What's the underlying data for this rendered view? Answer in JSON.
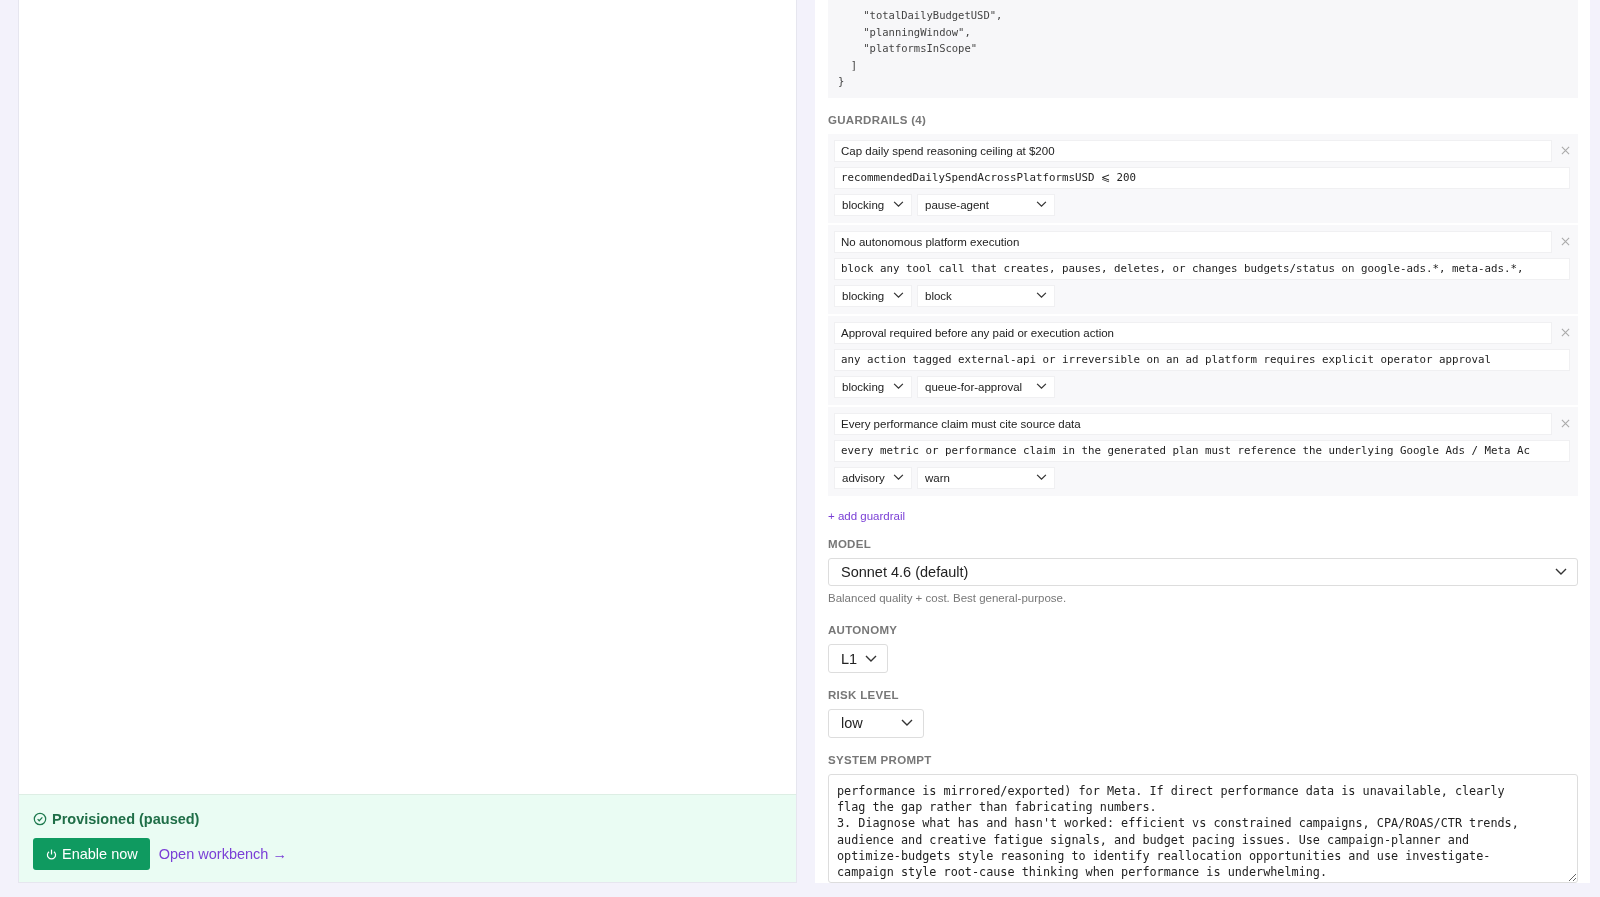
{
  "left_panel": {
    "status": {
      "label": "Provisioned (paused)"
    },
    "enable_button": "Enable now",
    "workbench_link": "Open workbench →"
  },
  "schema_code": [
    "    \"totalDailyBudgetUSD\",",
    "    \"planningWindow\",",
    "    \"platformsInScope\"",
    "  ]",
    "}"
  ],
  "guardrails": {
    "heading": "GUARDRAILS (4)",
    "items": [
      {
        "title": "Cap daily spend reasoning ceiling at $200",
        "rule": "recommendedDailySpendAcrossPlatformsUSD ⩽ 200",
        "severity": "blocking",
        "action": "pause-agent"
      },
      {
        "title": "No autonomous platform execution",
        "rule": "block any tool call that creates, pauses, deletes, or changes budgets/status on google-ads.*, meta-ads.*,",
        "severity": "blocking",
        "action": "block"
      },
      {
        "title": "Approval required before any paid or execution action",
        "rule": "any action tagged external-api or irreversible on an ad platform requires explicit operator approval",
        "severity": "blocking",
        "action": "queue-for-approval"
      },
      {
        "title": "Every performance claim must cite source data",
        "rule": "every metric or performance claim in the generated plan must reference the underlying Google Ads / Meta Ac",
        "severity": "advisory",
        "action": "warn"
      }
    ],
    "add_label": "+ add guardrail"
  },
  "model": {
    "label": "MODEL",
    "value": "Sonnet 4.6 (default)",
    "help": "Balanced quality + cost. Best general-purpose."
  },
  "autonomy": {
    "label": "AUTONOMY",
    "value": "L1"
  },
  "risk_level": {
    "label": "RISK LEVEL",
    "value": "low"
  },
  "system_prompt": {
    "label": "SYSTEM PROMPT",
    "value": "performance is mirrored/exported) for Meta. If direct performance data is unavailable, clearly\nflag the gap rather than fabricating numbers.\n3. Diagnose what has and hasn't worked: efficient vs constrained campaigns, CPA/ROAS/CTR trends,\naudience and creative fatigue signals, and budget pacing issues. Use campaign-planner and\noptimize-budgets style reasoning to identify reallocation opportunities and use investigate-\ncampaign style root-cause thinking when performance is underwhelming."
  }
}
